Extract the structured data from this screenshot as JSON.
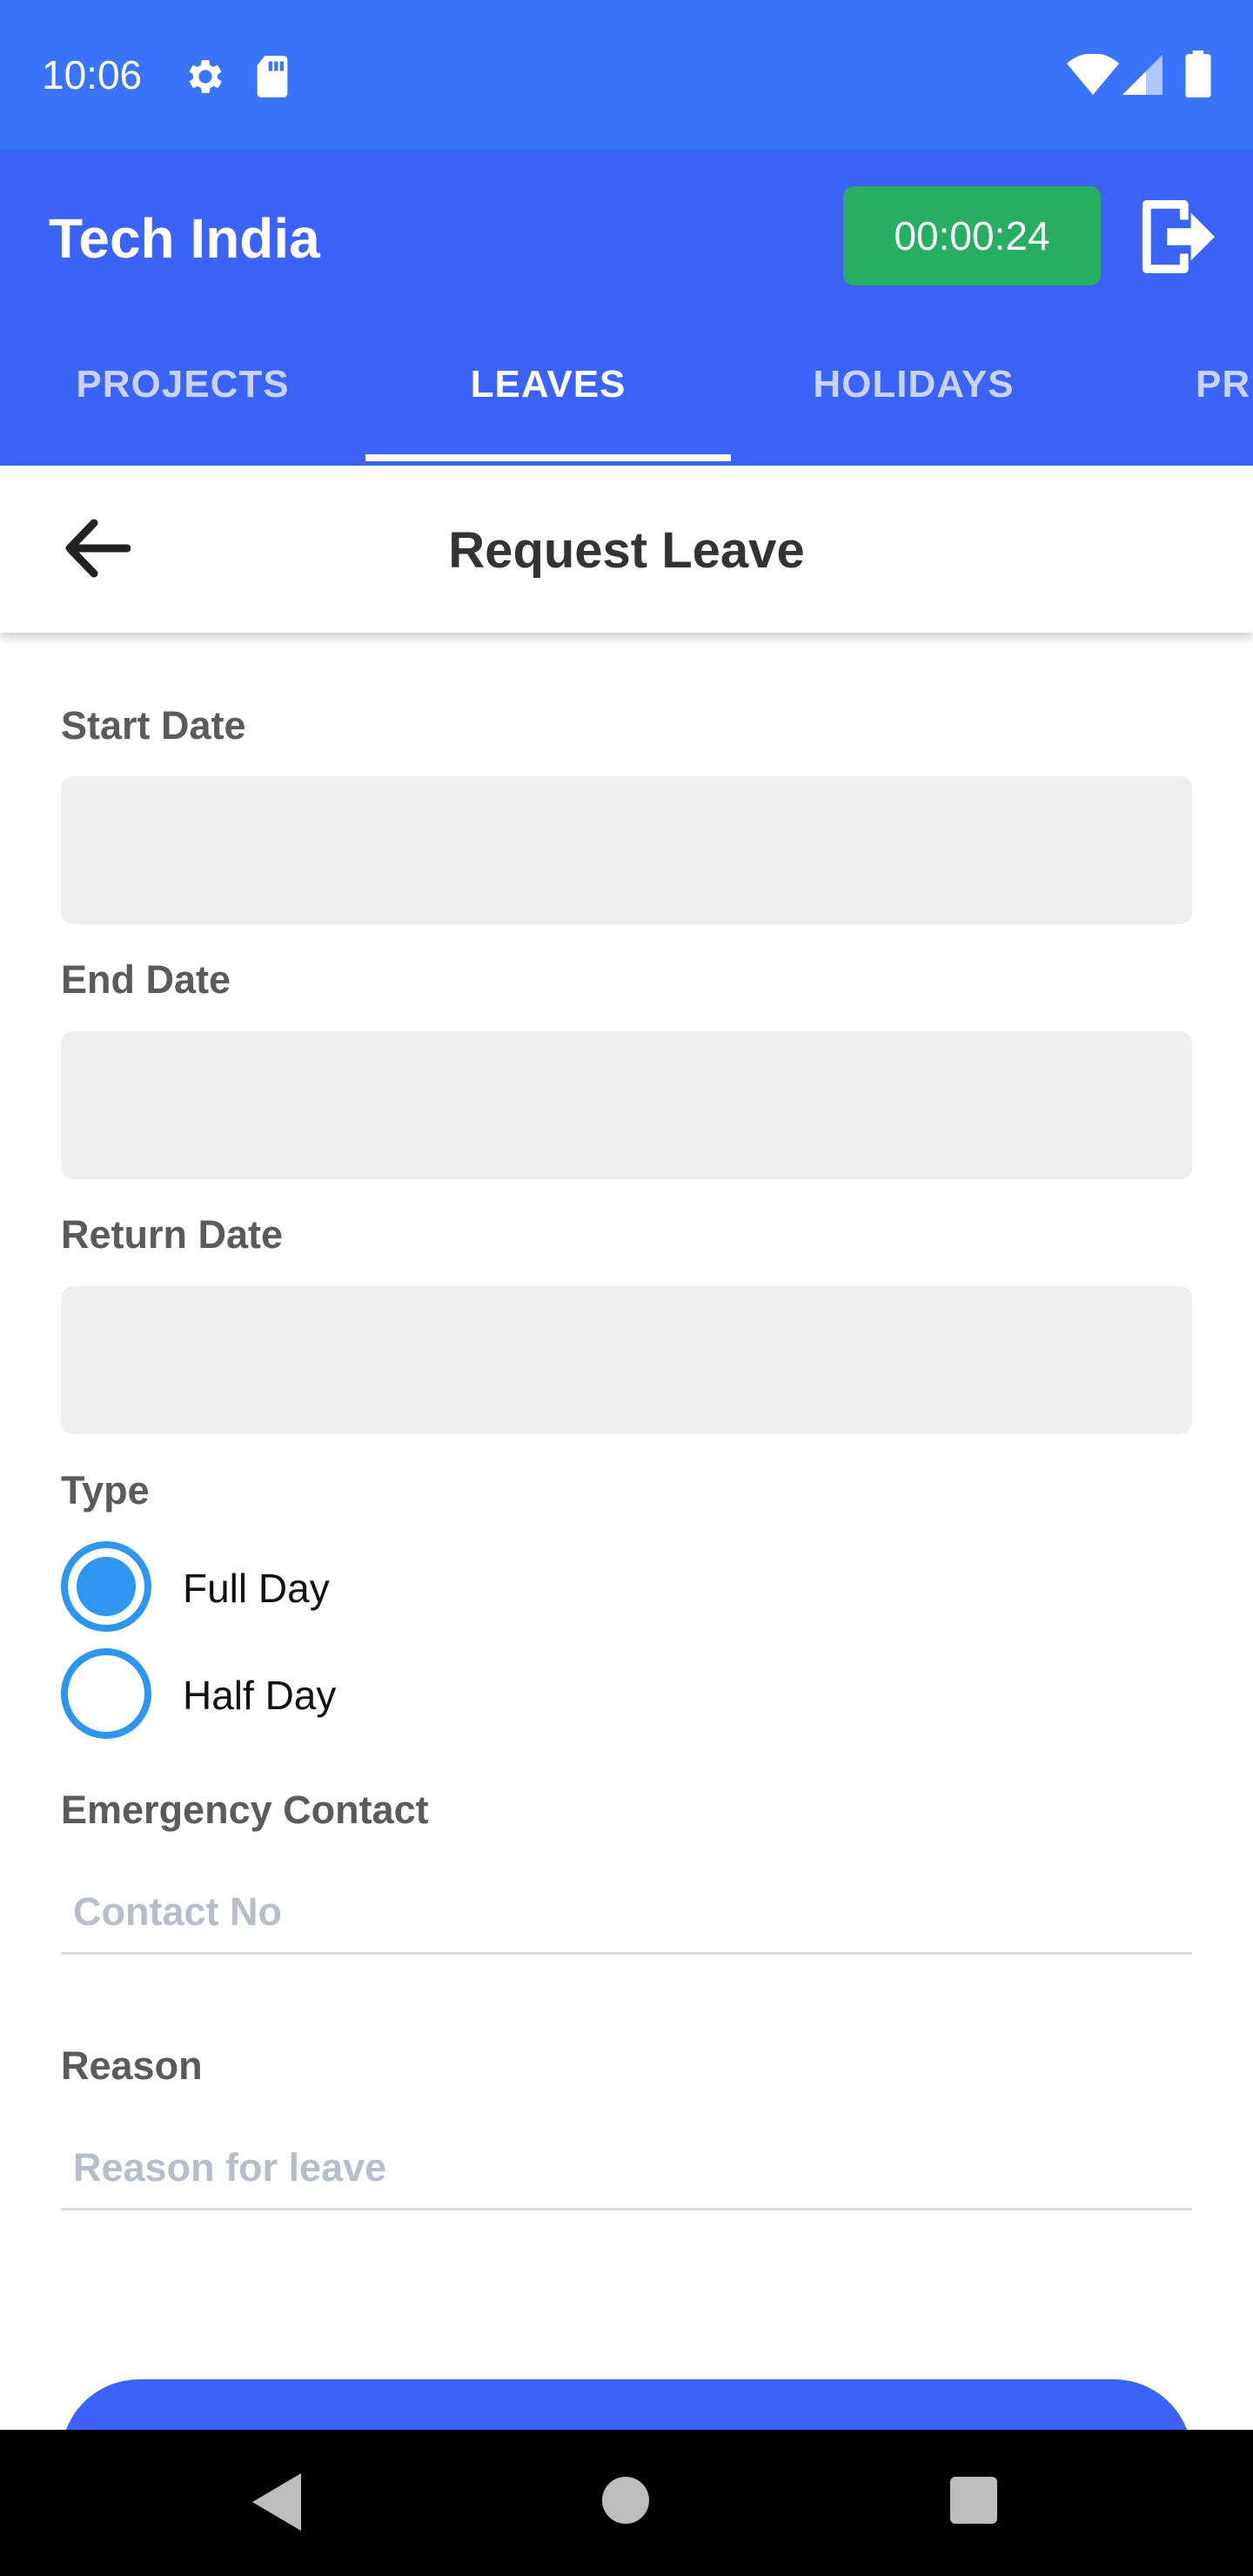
{
  "status_bar": {
    "time": "10:06",
    "icons": [
      "gear-icon",
      "sd-card-icon",
      "wifi-icon",
      "signal-icon",
      "battery-icon"
    ]
  },
  "app_bar": {
    "title": "Tech India",
    "timer": "00:00:24",
    "logout_icon": "logout-icon"
  },
  "tabs": [
    {
      "label": "PROJECTS",
      "active": false
    },
    {
      "label": "LEAVES",
      "active": true
    },
    {
      "label": "HOLIDAYS",
      "active": false
    },
    {
      "label": "PR",
      "active": false
    }
  ],
  "page": {
    "title": "Request Leave",
    "back_icon": "arrow-back-icon"
  },
  "form": {
    "start_date": {
      "label": "Start Date",
      "value": ""
    },
    "end_date": {
      "label": "End Date",
      "value": ""
    },
    "return_date": {
      "label": "Return Date",
      "value": ""
    },
    "type": {
      "label": "Type",
      "options": [
        "Full Day",
        "Half Day"
      ],
      "selected": "Full Day"
    },
    "emergency_contact": {
      "label": "Emergency Contact",
      "placeholder": "Contact No",
      "value": ""
    },
    "reason": {
      "label": "Reason",
      "placeholder": "Reason for leave",
      "value": ""
    }
  },
  "colors": {
    "status_bar": "#3a74fa",
    "app_bar": "#3b63f7",
    "timer_badge": "#27ae60",
    "radio_accent": "#2d96f1",
    "input_background": "#eeeeee"
  },
  "nav_bar": {
    "icons": [
      "nav-back-icon",
      "nav-home-icon",
      "nav-recents-icon"
    ]
  }
}
